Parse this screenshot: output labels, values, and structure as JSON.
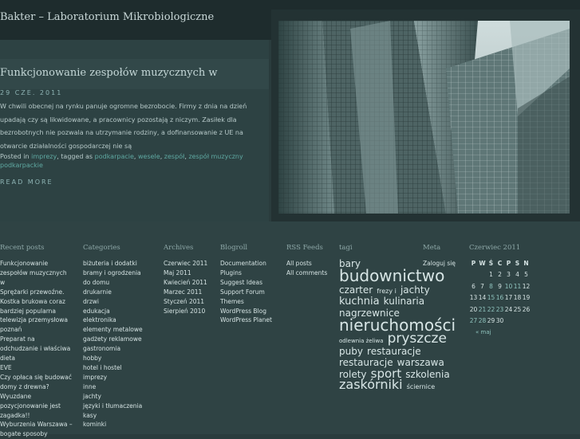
{
  "site": {
    "title": "Bakter – Laboratorium Mikrobiologiczne"
  },
  "post": {
    "title": "Funkcjonowanie zespołów muzycznych w",
    "date": "29 CZE. 2011",
    "body": "W chwili obecnej na rynku panuje ogromne bezrobocie. Firmy z dnia na dzień upadają czy są likwidowane, a pracownicy pozostają z niczym. Zasiłek dla bezrobotnych nie pozwala na utrzymanie rodziny, a dofinansowanie z UE na otwarcie działalności gospodarczej nie są",
    "meta_posted": "Posted in",
    "meta_category": "imprezy",
    "meta_tagged": ", tagged as",
    "meta_tags": [
      "podkarpacie",
      "wesele",
      "zespół",
      "zespół muzyczny podkarpackie"
    ],
    "read_more": "READ MORE"
  },
  "footer": {
    "recent": {
      "heading": "Recent posts",
      "items": [
        "Funkcjonowanie zespołów muzycznych w",
        "Sprężarki przewoźne.",
        "Kostka brukowa coraz bardziej popularna",
        "telewizja przemysłowa poznań",
        "Preparat na odchudzanie i właściwa dieta",
        "EVE",
        "Czy opłaca się budować domy z drewna?",
        "Wyuzdane pozycjonowanie jest zagadka!!",
        "Wyburzenia Warszawa – bogate sposoby"
      ]
    },
    "categories": {
      "heading": "Categories",
      "items": [
        "biżuteria i dodatki",
        "bramy i ogrodzenia",
        "do domu",
        "drukarnie",
        "drzwi",
        "edukacja",
        "elektronika",
        "elementy metalowe",
        "gadżety reklamowe",
        "gastronomia",
        "hobby",
        "hotel i hostel",
        "imprezy",
        "inne",
        "jachty",
        "języki i tłumaczenia",
        "kasy",
        "kominki"
      ]
    },
    "archives": {
      "heading": "Archives",
      "items": [
        "Czerwiec 2011",
        "Maj 2011",
        "Kwiecień 2011",
        "Marzec 2011",
        "Styczeń 2011",
        "Sierpień 2010"
      ]
    },
    "blogroll": {
      "heading": "Blogroll",
      "items": [
        "Documentation",
        "Plugins",
        "Suggest Ideas",
        "Support Forum",
        "Themes",
        "WordPress Blog",
        "WordPress Planet"
      ]
    },
    "rss": {
      "heading": "RSS Feeds",
      "items": [
        "All posts",
        "All comments"
      ]
    },
    "tags": {
      "heading": "tagi",
      "items": [
        {
          "t": "bary",
          "s": 12
        },
        {
          "t": "budownictwo",
          "s": 20
        },
        {
          "t": "czarter",
          "s": 12
        },
        {
          "t": "frezy i",
          "s": 8
        },
        {
          "t": "jachty",
          "s": 12
        },
        {
          "t": "kuchnia",
          "s": 13
        },
        {
          "t": "kulinaria",
          "s": 12
        },
        {
          "t": "nagrzewnice",
          "s": 12
        },
        {
          "t": "nieruchomości",
          "s": 20
        },
        {
          "t": "odlewnia żeliwa",
          "s": 7
        },
        {
          "t": "pryszcze",
          "s": 17
        },
        {
          "t": "puby",
          "s": 12
        },
        {
          "t": "restauracje",
          "s": 12
        },
        {
          "t": "restauracje",
          "s": 12
        },
        {
          "t": "warszawa",
          "s": 12
        },
        {
          "t": "rolety",
          "s": 12
        },
        {
          "t": "sport",
          "s": 15
        },
        {
          "t": "szkolenia",
          "s": 12
        },
        {
          "t": "zaskórniki",
          "s": 16
        },
        {
          "t": "ściernice",
          "s": 8
        }
      ]
    },
    "meta": {
      "heading": "Meta",
      "items": [
        "Zaloguj się"
      ]
    },
    "calendar": {
      "heading": "Czerwiec 2011",
      "days": [
        "P",
        "W",
        "Ś",
        "C",
        "P",
        "S",
        "N"
      ],
      "weeks": [
        [
          "",
          "",
          "1",
          "2",
          "3",
          "4",
          "5"
        ],
        [
          "6",
          "7",
          "8",
          "9",
          "10",
          "11",
          "12"
        ],
        [
          "13",
          "14",
          "15",
          "16",
          "17",
          "18",
          "19"
        ],
        [
          "20",
          "21",
          "22",
          "23",
          "24",
          "25",
          "26"
        ],
        [
          "27",
          "28",
          "29",
          "30",
          "",
          "",
          ""
        ]
      ],
      "prev": "« maj"
    }
  }
}
